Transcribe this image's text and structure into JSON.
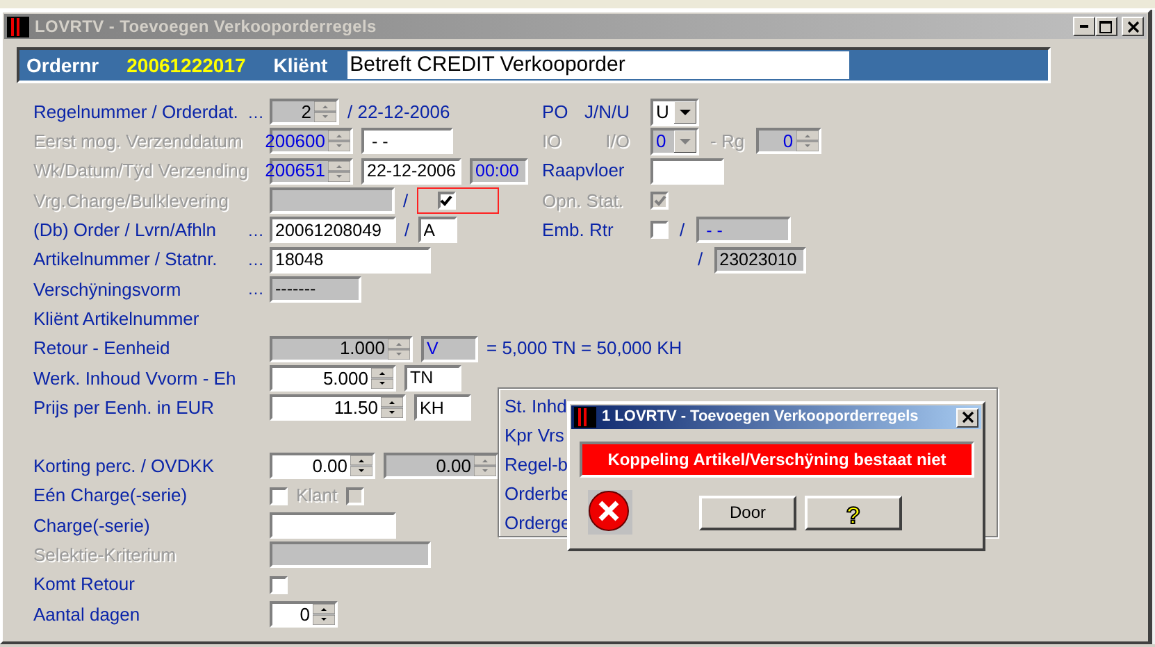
{
  "window": {
    "title": "LOVRTV - Toevoegen Verkooporderregels",
    "active": false
  },
  "header": {
    "order_label": "Ordernr",
    "order_number": "20061222017",
    "client_label": "Kliënt",
    "client_value": "Betreft CREDIT Verkooporder"
  },
  "sections": [
    {
      "rows": [
        {
          "label": "Regelnummer / Orderdat.",
          "enabled": true,
          "dots": "…",
          "fields": [
            {
              "kind": "spin",
              "value": "2",
              "readonly": true,
              "computed": false
            },
            {
              "kind": "text",
              "value": "/ 22-12-2006"
            }
          ],
          "side": [
            {
              "kind": "label",
              "value": "PO",
              "enabled": true
            },
            {
              "kind": "label",
              "value": "J/N/U",
              "enabled": true
            },
            {
              "kind": "select",
              "value": "U",
              "disabled": false
            }
          ]
        },
        {
          "label": "Eerst mog. Verzenddatum",
          "enabled": false,
          "fields": [
            {
              "kind": "spin",
              "value": "200600",
              "readonly": true,
              "computed": true
            },
            {
              "kind": "field",
              "value": " - -",
              "readonly": false,
              "computed": false
            }
          ],
          "side": [
            {
              "kind": "label",
              "value": "IO",
              "enabled": false
            },
            {
              "kind": "label",
              "value": "I/O",
              "enabled": false
            },
            {
              "kind": "select",
              "value": "0",
              "disabled": true
            },
            {
              "kind": "label",
              "value": "- Rg",
              "enabled": false
            },
            {
              "kind": "spin",
              "value": "0",
              "readonly": true,
              "computed": true
            }
          ]
        },
        {
          "label": "Wk/Datum/Tÿd Verzending",
          "enabled": false,
          "fields": [
            {
              "kind": "spin",
              "value": "200651",
              "readonly": true,
              "computed": true
            },
            {
              "kind": "field",
              "value": "22-12-2006",
              "readonly": false,
              "computed": false
            },
            {
              "kind": "field",
              "value": "00:00",
              "readonly": true,
              "computed": true
            }
          ],
          "side": [
            {
              "kind": "label",
              "value": "Raapvloer",
              "enabled": true
            },
            {
              "kind": "field",
              "readonly": false
            }
          ]
        },
        {
          "label": "Vrg.Charge/Bulklevering",
          "enabled": false,
          "fields": [
            {
              "kind": "field",
              "readonly": true
            },
            {
              "kind": "separator",
              "value": "/"
            },
            {
              "kind": "check",
              "checked": true,
              "disabled": false,
              "flagged": true
            }
          ],
          "side": [
            {
              "kind": "label",
              "value": "Opn. Stat.",
              "enabled": false
            },
            {
              "kind": "check",
              "checked": true,
              "disabled": true
            }
          ]
        },
        {
          "label": "(Db) Order / Lvrn/Afhln",
          "enabled": true,
          "dots": "…",
          "fields": [
            {
              "kind": "field",
              "value": "20061208049",
              "readonly": false,
              "computed": false
            },
            {
              "kind": "separator",
              "value": "/"
            },
            {
              "kind": "field",
              "value": "A",
              "readonly": false,
              "computed": false
            }
          ],
          "side": [
            {
              "kind": "label",
              "value": "Emb. Rtr",
              "enabled": true
            },
            {
              "kind": "check",
              "checked": false,
              "disabled": false
            },
            {
              "kind": "separator",
              "value": "/"
            },
            {
              "kind": "field",
              "value": " - -",
              "readonly": true,
              "computed": true
            }
          ]
        },
        {
          "label": "Artikelnummer / Statnr.",
          "enabled": true,
          "dots": "…",
          "fields": [
            {
              "kind": "field",
              "value": "18048",
              "readonly": false,
              "computed": false
            }
          ],
          "side": [
            {
              "kind": "separator",
              "value": "/"
            },
            {
              "kind": "field",
              "value": "23023010",
              "readonly": true,
              "computed": false
            }
          ]
        },
        {
          "label": "Verschÿningsvorm",
          "enabled": true,
          "dots": "…",
          "fields": [
            {
              "kind": "field",
              "value": "-------",
              "readonly": true,
              "computed": false
            }
          ],
          "side": []
        },
        {
          "label": "Kliënt Artikelnummer",
          "enabled": true,
          "fields": [],
          "side": []
        },
        {
          "label": "Retour - Eenheid",
          "enabled": true,
          "fields": [
            {
              "kind": "spin",
              "value": "1.000",
              "readonly": true,
              "computed": false
            },
            {
              "kind": "field",
              "value": "V",
              "readonly": true,
              "computed": true
            },
            {
              "kind": "text",
              "value": "= 5,000 TN = 50,000 KH"
            }
          ],
          "side": []
        },
        {
          "label": "Werk. Inhoud Vvorm - Eh",
          "enabled": true,
          "fields": [
            {
              "kind": "spin",
              "value": "5.000",
              "readonly": false,
              "computed": false
            },
            {
              "kind": "field",
              "value": "TN",
              "readonly": false,
              "computed": false
            }
          ],
          "side": []
        },
        {
          "label": "Prijs per Eenh. in EUR",
          "enabled": true,
          "fields": [
            {
              "kind": "spin",
              "value": "11.50",
              "readonly": false,
              "computed": false
            },
            {
              "kind": "field",
              "value": "KH",
              "readonly": false,
              "computed": false
            }
          ],
          "side": []
        }
      ]
    },
    {
      "rows": [
        {
          "label": "Korting perc. / OVDKK",
          "enabled": true,
          "fields": [
            {
              "kind": "spin",
              "value": "0.00",
              "readonly": false,
              "computed": false
            },
            {
              "kind": "spin",
              "value": "0.00",
              "readonly": true,
              "computed": false
            }
          ],
          "side": []
        },
        {
          "label": "Eén Charge(-serie)",
          "enabled": true,
          "fields": [
            {
              "kind": "check",
              "checked": false,
              "disabled": false
            },
            {
              "kind": "label",
              "value": "Klant",
              "enabled": false
            },
            {
              "kind": "check",
              "checked": false,
              "disabled": true
            }
          ],
          "side": []
        },
        {
          "label": "Charge(-serie)",
          "enabled": true,
          "fields": [
            {
              "kind": "field",
              "readonly": false
            }
          ],
          "side": []
        },
        {
          "label": "Selektie-Kriterium",
          "enabled": false,
          "fields": [
            {
              "kind": "field",
              "readonly": true
            }
          ],
          "side": []
        },
        {
          "label": "Komt Retour",
          "enabled": true,
          "fields": [
            {
              "kind": "check",
              "checked": false,
              "disabled": false
            }
          ],
          "side": []
        },
        {
          "label": "Aantal dagen",
          "enabled": true,
          "fields": [
            {
              "kind": "spin",
              "value": "0",
              "readonly": false,
              "computed": false
            }
          ],
          "side": []
        }
      ]
    }
  ],
  "summary_box": {
    "labels": [
      "St. Inhd",
      "Kpr Vrs",
      "Regel-b",
      "Orderbe",
      "Orderge"
    ]
  },
  "dialog": {
    "title": "1 LOVRTV - Toevoegen Verkooporderregels",
    "active": true,
    "message": "Koppeling Artikel/Verschÿning bestaat niet",
    "buttons": [
      {
        "kind": "text",
        "label": "Door"
      },
      {
        "kind": "help",
        "label": "?"
      }
    ]
  }
}
